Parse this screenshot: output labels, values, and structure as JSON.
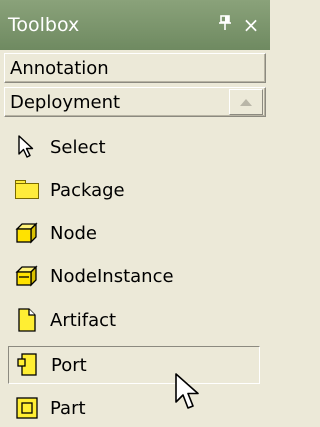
{
  "window": {
    "title": "Toolbox",
    "pin_glyph": "❡",
    "close_glyph": "×"
  },
  "groups": [
    {
      "label": "Annotation"
    },
    {
      "label": "Deployment"
    }
  ],
  "items": [
    {
      "label": "Select",
      "icon": "pointer-arrow-icon"
    },
    {
      "label": "Package",
      "icon": "folder-icon"
    },
    {
      "label": "Node",
      "icon": "node-cube-icon"
    },
    {
      "label": "NodeInstance",
      "icon": "node-instance-icon"
    },
    {
      "label": "Artifact",
      "icon": "artifact-icon"
    },
    {
      "label": "Port",
      "icon": "port-icon",
      "selected": true
    },
    {
      "label": "Part",
      "icon": "part-icon"
    }
  ],
  "colors": {
    "titlebar": "#7b9470",
    "panel": "#ece9d8",
    "icon_yellow": "#ffee33"
  }
}
